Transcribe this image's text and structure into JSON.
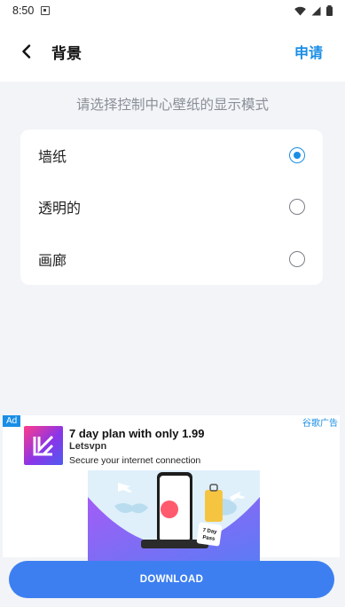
{
  "status_bar": {
    "time": "8:50"
  },
  "header": {
    "title": "背景",
    "apply_label": "申请"
  },
  "main": {
    "subtitle": "请选择控制中心壁纸的显示模式",
    "options": [
      {
        "label": "墙纸",
        "selected": true
      },
      {
        "label": "透明的",
        "selected": false
      },
      {
        "label": "画廊",
        "selected": false
      }
    ]
  },
  "ad": {
    "tag": "Ad",
    "source": "谷歌广告",
    "title": "7 day plan with only 1.99",
    "brand": "Letsvpn",
    "description": "Secure your internet connection",
    "banner_badge_line1": "7 Day",
    "banner_badge_line2": "Pass",
    "cta": "DOWNLOAD"
  },
  "colors": {
    "accent": "#1a8ee6",
    "cta": "#3d7ff0",
    "background": "#f2f4f7"
  }
}
